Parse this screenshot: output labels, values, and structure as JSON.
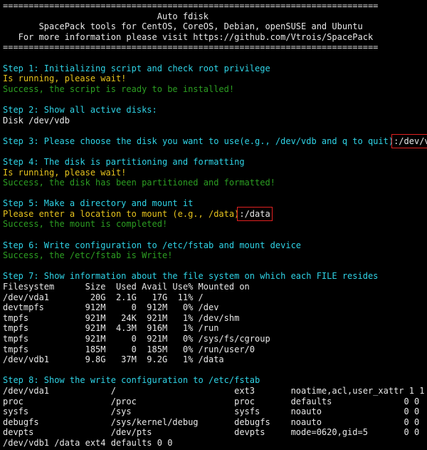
{
  "colors": {
    "background": "#000000",
    "text": "#e8e8e8",
    "step": "#2fd3e6",
    "running": "#e6c31e",
    "success": "#2c9e22",
    "highlight_box": "#e02020"
  },
  "lines": [
    {
      "segments": [
        {
          "text": "=========================================================================",
          "style": "white"
        }
      ]
    },
    {
      "segments": [
        {
          "text": "                              Auto fdisk",
          "style": "white"
        }
      ]
    },
    {
      "segments": [
        {
          "text": "       SpacePack tools for CentOS, CoreOS, Debian, openSUSE and Ubuntu",
          "style": "white"
        }
      ]
    },
    {
      "segments": [
        {
          "text": "   For more information please visit https://github.com/Vtrois/SpacePack",
          "style": "white"
        }
      ]
    },
    {
      "segments": [
        {
          "text": "=========================================================================",
          "style": "white"
        }
      ]
    },
    {
      "segments": [
        {
          "text": "",
          "style": "white"
        }
      ]
    },
    {
      "segments": [
        {
          "text": "Step 1: Initializing script and check root privilege",
          "style": "cyan"
        }
      ]
    },
    {
      "segments": [
        {
          "text": "Is running, please wait!",
          "style": "yellow"
        }
      ]
    },
    {
      "segments": [
        {
          "text": "Success, the script is ready to be installed!",
          "style": "green"
        }
      ]
    },
    {
      "segments": [
        {
          "text": "",
          "style": "white"
        }
      ]
    },
    {
      "segments": [
        {
          "text": "Step 2: Show all active disks:",
          "style": "cyan"
        }
      ]
    },
    {
      "segments": [
        {
          "text": "Disk /dev/vdb",
          "style": "white"
        }
      ]
    },
    {
      "segments": [
        {
          "text": "",
          "style": "white"
        }
      ]
    },
    {
      "segments": [
        {
          "text": "Step 3: Please choose the disk you want to use(e.g., /dev/vdb and q to quit)",
          "style": "cyan"
        },
        {
          "text": ":/dev/vdb",
          "style": "white",
          "highlight": true
        }
      ]
    },
    {
      "segments": [
        {
          "text": "",
          "style": "white"
        }
      ]
    },
    {
      "segments": [
        {
          "text": "Step 4: The disk is partitioning and formatting",
          "style": "cyan"
        }
      ]
    },
    {
      "segments": [
        {
          "text": "Is running, please wait!",
          "style": "yellow"
        }
      ]
    },
    {
      "segments": [
        {
          "text": "Success, the disk has been partitioned and formatted!",
          "style": "green"
        }
      ]
    },
    {
      "segments": [
        {
          "text": "",
          "style": "white"
        }
      ]
    },
    {
      "segments": [
        {
          "text": "Step 5: Make a directory and mount it",
          "style": "cyan"
        }
      ]
    },
    {
      "segments": [
        {
          "text": "Please enter a location to mount (e.g., /data)",
          "style": "yellow"
        },
        {
          "text": ":/data",
          "style": "white",
          "highlight": true
        }
      ]
    },
    {
      "segments": [
        {
          "text": "Success, the mount is completed!",
          "style": "green"
        }
      ]
    },
    {
      "segments": [
        {
          "text": "",
          "style": "white"
        }
      ]
    },
    {
      "segments": [
        {
          "text": "Step 6: Write configuration to /etc/fstab and mount device",
          "style": "cyan"
        }
      ]
    },
    {
      "segments": [
        {
          "text": "Success, the /etc/fstab is Write!",
          "style": "green"
        }
      ]
    },
    {
      "segments": [
        {
          "text": "",
          "style": "white"
        }
      ]
    },
    {
      "segments": [
        {
          "text": "Step 7: Show information about the file system on which each FILE resides",
          "style": "cyan"
        }
      ]
    },
    {
      "segments": [
        {
          "text": "Filesystem      Size  Used Avail Use% Mounted on",
          "style": "white"
        }
      ]
    },
    {
      "segments": [
        {
          "text": "/dev/vda1        20G  2.1G   17G  11% /",
          "style": "white"
        }
      ]
    },
    {
      "segments": [
        {
          "text": "devtmpfs        912M     0  912M   0% /dev",
          "style": "white"
        }
      ]
    },
    {
      "segments": [
        {
          "text": "tmpfs           921M   24K  921M   1% /dev/shm",
          "style": "white"
        }
      ]
    },
    {
      "segments": [
        {
          "text": "tmpfs           921M  4.3M  916M   1% /run",
          "style": "white"
        }
      ]
    },
    {
      "segments": [
        {
          "text": "tmpfs           921M     0  921M   0% /sys/fs/cgroup",
          "style": "white"
        }
      ]
    },
    {
      "segments": [
        {
          "text": "tmpfs           185M     0  185M   0% /run/user/0",
          "style": "white"
        }
      ]
    },
    {
      "segments": [
        {
          "text": "/dev/vdb1       9.8G   37M  9.2G   1% /data",
          "style": "white"
        }
      ]
    },
    {
      "segments": [
        {
          "text": "",
          "style": "white"
        }
      ]
    },
    {
      "segments": [
        {
          "text": "Step 8: Show the write configuration to /etc/fstab",
          "style": "cyan"
        }
      ]
    },
    {
      "segments": [
        {
          "text": "/dev/vda1            /                       ext3       noatime,acl,user_xattr 1 1",
          "style": "white"
        }
      ]
    },
    {
      "segments": [
        {
          "text": "proc                 /proc                   proc       defaults              0 0",
          "style": "white"
        }
      ]
    },
    {
      "segments": [
        {
          "text": "sysfs                /sys                    sysfs      noauto                0 0",
          "style": "white"
        }
      ]
    },
    {
      "segments": [
        {
          "text": "debugfs              /sys/kernel/debug       debugfs    noauto                0 0",
          "style": "white"
        }
      ]
    },
    {
      "segments": [
        {
          "text": "devpts               /dev/pts                devpts     mode=0620,gid=5       0 0",
          "style": "white"
        }
      ]
    },
    {
      "segments": [
        {
          "text": "/dev/vdb1 /data ext4 defaults 0 0",
          "style": "white"
        }
      ]
    }
  ]
}
